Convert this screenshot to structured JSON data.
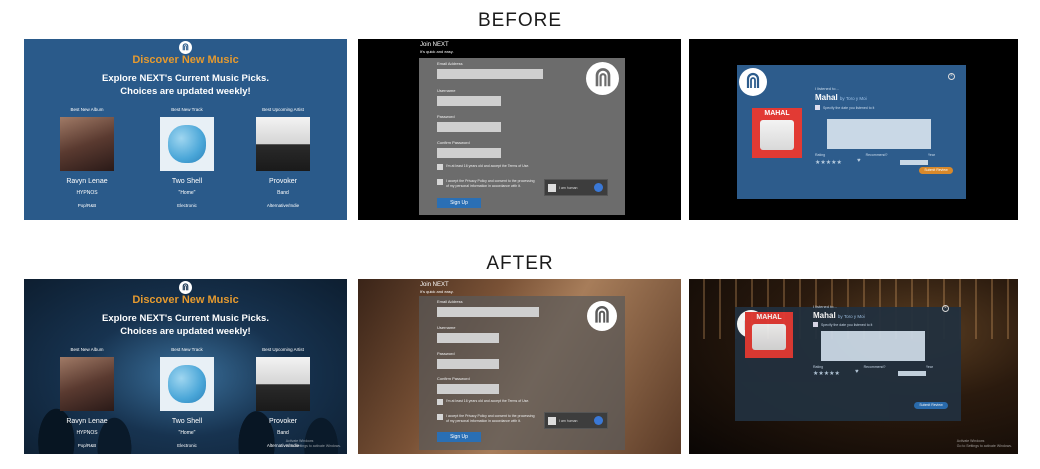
{
  "headings": {
    "before": "BEFORE",
    "after": "AFTER"
  },
  "discover": {
    "title": "Discover New Music",
    "subtitle_line1": "Explore NEXT's Current Music Picks.",
    "subtitle_line2": "Choices are updated weekly!",
    "columns": [
      {
        "label": "Best New Album",
        "name": "Ravyn Lenae",
        "desc": "HYPNOS",
        "genre": "Pop/R&B"
      },
      {
        "label": "Best New Track",
        "name": "Two Shell",
        "desc": "\"Home\"",
        "genre": "Electronic"
      },
      {
        "label": "Best Upcoming Artist",
        "name": "Provoker",
        "desc": "Band",
        "genre": "Alternative/Indie"
      }
    ]
  },
  "signup": {
    "title": "Join NEXT",
    "subtitle": "It's quick and easy.",
    "fields": [
      "Email Address",
      "Username",
      "Password",
      "Confirm Password"
    ],
    "age_check": "I'm at least 16 years old and accept the Terms of Use.",
    "privacy_check": "I accept the Privacy Policy and consent to the processing of my personal information in accordance with it.",
    "captcha_label": "I am human",
    "button": "Sign Up"
  },
  "review": {
    "listened": "I listened to...",
    "album_title": "Mahal",
    "artist": "by Toro y Moi",
    "album_art_text": "MAHAL",
    "specify": "Specify the date you listened to it",
    "rating_label": "Rating",
    "recommend_label": "Recommend?",
    "year_label": "Year",
    "stars": "★★★★★",
    "heart": "♥",
    "close": "×",
    "submit": "Submit Review"
  },
  "watermark": {
    "line1": "Activate Windows",
    "line2": "Go to Settings to activate Windows."
  },
  "colors": {
    "accent_orange": "#e59a2f",
    "panel_blue": "#2a5a8a",
    "button_blue": "#2a6fb4"
  }
}
